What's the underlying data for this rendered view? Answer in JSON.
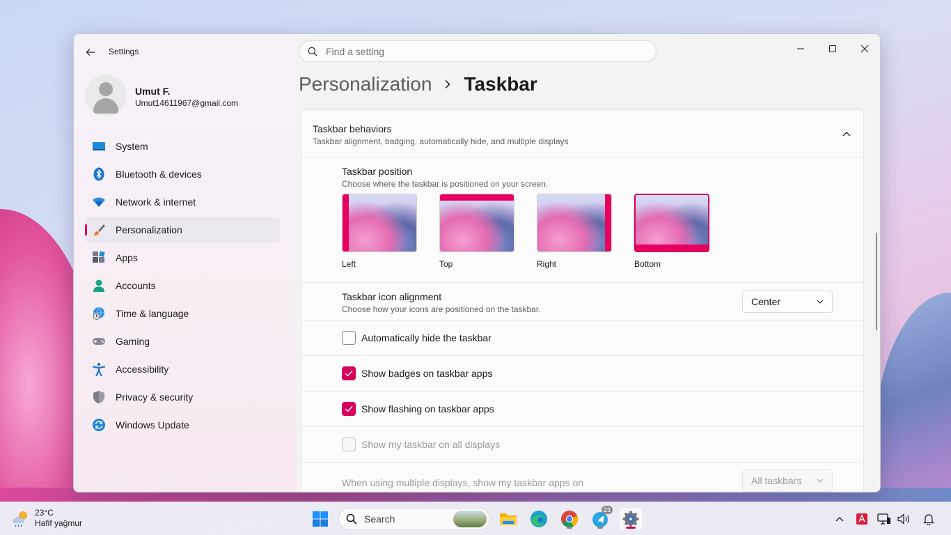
{
  "window": {
    "app_title": "Settings",
    "search_placeholder": "Find a setting"
  },
  "profile": {
    "name": "Umut F.",
    "email": "Umut14611967@gmail.com"
  },
  "sidebar": {
    "items": [
      {
        "label": "System",
        "icon": "monitor-icon"
      },
      {
        "label": "Bluetooth & devices",
        "icon": "bluetooth-icon"
      },
      {
        "label": "Network & internet",
        "icon": "wifi-icon"
      },
      {
        "label": "Personalization",
        "icon": "brush-icon",
        "active": true
      },
      {
        "label": "Apps",
        "icon": "apps-icon"
      },
      {
        "label": "Accounts",
        "icon": "accounts-icon"
      },
      {
        "label": "Time & language",
        "icon": "globe-clock-icon"
      },
      {
        "label": "Gaming",
        "icon": "gamepad-icon"
      },
      {
        "label": "Accessibility",
        "icon": "accessibility-icon"
      },
      {
        "label": "Privacy & security",
        "icon": "shield-icon"
      },
      {
        "label": "Windows Update",
        "icon": "update-icon"
      }
    ]
  },
  "breadcrumb": {
    "parent": "Personalization",
    "current": "Taskbar"
  },
  "section": {
    "title": "Taskbar behaviors",
    "subtitle": "Taskbar alignment, badging, automatically hide, and multiple displays"
  },
  "taskbar_position": {
    "title": "Taskbar position",
    "subtitle": "Choose where the taskbar is positioned on your screen.",
    "options": [
      "Left",
      "Top",
      "Right",
      "Bottom"
    ],
    "selected": "Bottom"
  },
  "icon_alignment": {
    "title": "Taskbar icon alignment",
    "subtitle": "Choose how your icons are positioned on the taskbar.",
    "value": "Center"
  },
  "checkboxes": [
    {
      "label": "Automatically hide the taskbar",
      "checked": false,
      "enabled": true
    },
    {
      "label": "Show badges on taskbar apps",
      "checked": true,
      "enabled": true
    },
    {
      "label": "Show flashing on taskbar apps",
      "checked": true,
      "enabled": true
    },
    {
      "label": "Show my taskbar on all displays",
      "checked": false,
      "enabled": false
    }
  ],
  "multi_display": {
    "label": "When using multiple displays, show my taskbar apps on",
    "value": "All taskbars"
  },
  "taskbar": {
    "temperature": "23°C",
    "weather_desc": "Hafif yağmur",
    "search_label": "Search",
    "telegram_badge": "23"
  },
  "colors": {
    "accent": "#d6005c"
  }
}
